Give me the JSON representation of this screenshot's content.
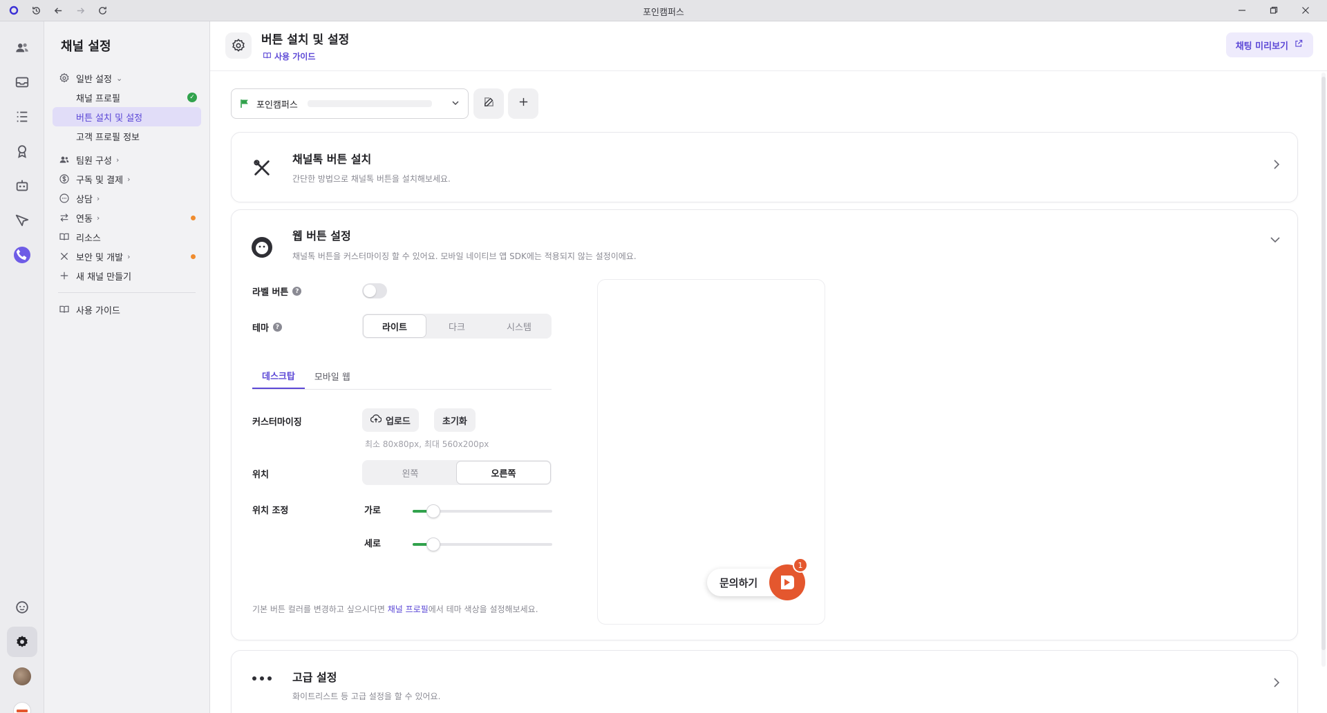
{
  "window": {
    "title": "포인캠퍼스"
  },
  "nav": {
    "title": "채널 설정",
    "items": [
      {
        "label": "일반 설정",
        "icon": "gear-icon"
      },
      {
        "label": "채널 프로필"
      },
      {
        "label": "버튼 설치 및 설정"
      },
      {
        "label": "고객 프로필 정보"
      },
      {
        "label": "팀원 구성",
        "icon": "people-icon"
      },
      {
        "label": "구독 및 결제",
        "icon": "dollar-icon"
      },
      {
        "label": "상담",
        "icon": "chat-bubble-icon"
      },
      {
        "label": "연동",
        "icon": "swap-icon"
      },
      {
        "label": "리소스",
        "icon": "book-icon"
      },
      {
        "label": "보안 및 개발",
        "icon": "tools-icon"
      },
      {
        "label": "새 채널 만들기",
        "icon": "plus-icon"
      },
      {
        "label": "사용 가이드",
        "icon": "book-icon"
      }
    ]
  },
  "header": {
    "title": "버튼 설치 및 설정",
    "guide_label": "사용 가이드",
    "preview_label": "채팅 미리보기"
  },
  "channel_select": {
    "value": "포인캠퍼스"
  },
  "install_card": {
    "title": "채널톡 버튼 설치",
    "desc": "간단한 방법으로 채널톡 버튼을 설치해보세요."
  },
  "web_card": {
    "title": "웹 버튼 설정",
    "desc": "채널톡 버튼을 커스터마이징 할 수 있어요. 모바일 네이티브 앱 SDK에는 적용되지 않는 설정이에요.",
    "label_button": {
      "label": "라벨 버튼",
      "enabled": false
    },
    "theme": {
      "label": "테마",
      "options": [
        "라이트",
        "다크",
        "시스템"
      ],
      "selected": "라이트"
    },
    "tabs": [
      "데스크탑",
      "모바일 웹"
    ],
    "active_tab": "데스크탑",
    "customizing": {
      "label": "커스터마이징",
      "upload_label": "업로드",
      "reset_label": "초기화",
      "hint": "최소 80x80px, 최대 560x200px"
    },
    "position": {
      "label": "위치",
      "options": [
        "왼쪽",
        "오른쪽"
      ],
      "selected": "오른쪽"
    },
    "position_adjust": {
      "label": "위치 조정",
      "horizontal_label": "가로",
      "vertical_label": "세로",
      "horizontal_value": 0.15,
      "vertical_value": 0.15
    },
    "footnote_before": "기본 버튼 컬러를 변경하고 싶으시다면 ",
    "footnote_link": "채널 프로필",
    "footnote_after": "에서 테마 색상을 설정해보세요.",
    "preview": {
      "button_label": "문의하기",
      "badge_count": "1"
    }
  },
  "advanced_card": {
    "title": "고급 설정",
    "desc": "화이트리스트 등 고급 설정을 할 수 있어요."
  },
  "colors": {
    "accent": "#5b47d6",
    "brand_orange": "#e4572e",
    "success": "#31a24c"
  }
}
